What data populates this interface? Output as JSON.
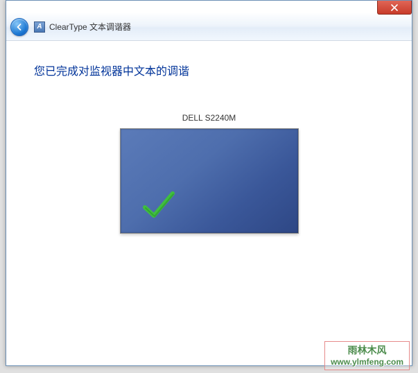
{
  "window": {
    "title": "ClearType 文本调谐器",
    "app_icon_letter": "A"
  },
  "content": {
    "heading": "您已完成对监视器中文本的调谐",
    "monitor_name": "DELL S2240M"
  },
  "watermark": {
    "text_cn": "雨林木风",
    "url": "www.ylmfeng.com"
  }
}
